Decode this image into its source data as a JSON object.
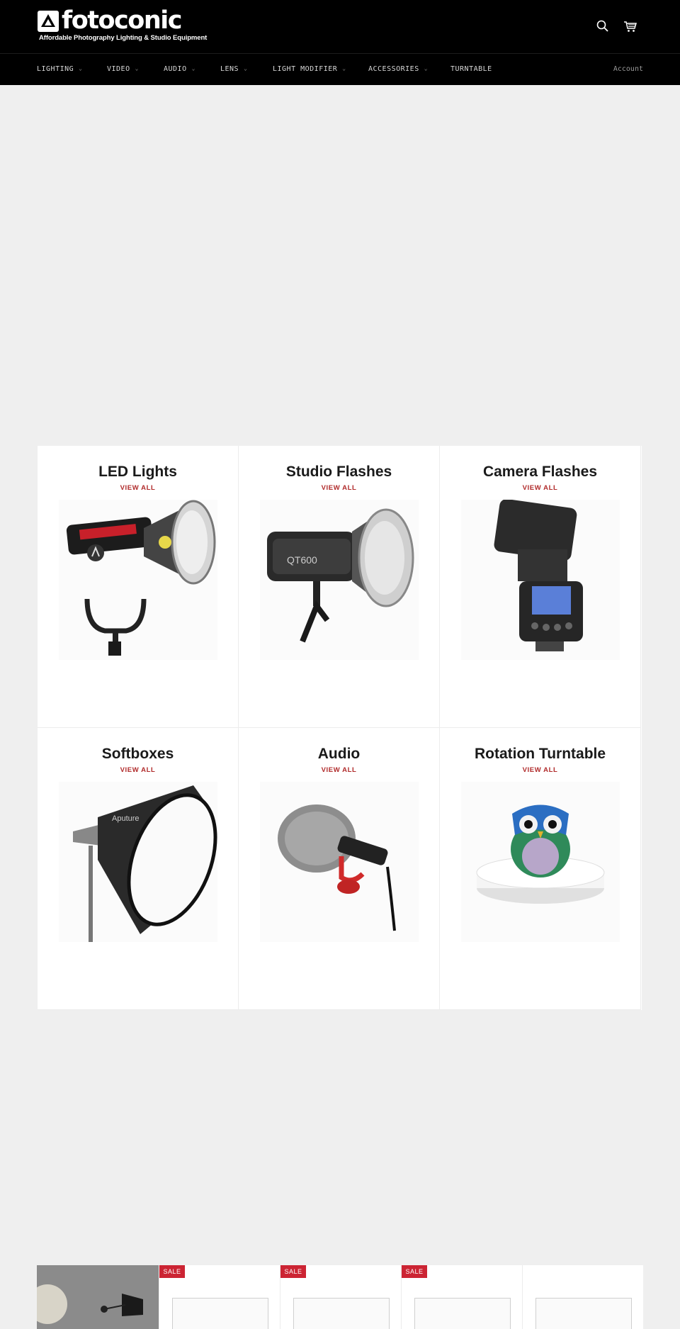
{
  "brand": {
    "name": "fotoconic",
    "tagline": "Affordable Photography Lighting & Studio Equipment"
  },
  "header": {
    "icons": [
      "search-icon",
      "cart-icon"
    ]
  },
  "nav": {
    "items": [
      "LIGHTING",
      "VIDEO",
      "AUDIO",
      "LENS",
      "LIGHT MODIFIER",
      "ACCESSORIES",
      "TURNTABLE"
    ],
    "account": "Account"
  },
  "collections": [
    {
      "title": "LED Lights",
      "link": "VIEW ALL"
    },
    {
      "title": "Studio Flashes",
      "link": "VIEW ALL"
    },
    {
      "title": "Camera Flashes",
      "link": "VIEW ALL"
    },
    {
      "title": "Softboxes",
      "link": "VIEW ALL"
    },
    {
      "title": "Audio",
      "link": "VIEW ALL"
    },
    {
      "title": "Rotation Turntable",
      "link": "VIEW ALL"
    }
  ],
  "products": {
    "badges": [
      "SALE",
      "SALE",
      "SALE"
    ]
  },
  "colors": {
    "header_bg": "#000000",
    "page_bg": "#efefef",
    "accent": "#b02a2a",
    "sale": "#cc2433"
  }
}
